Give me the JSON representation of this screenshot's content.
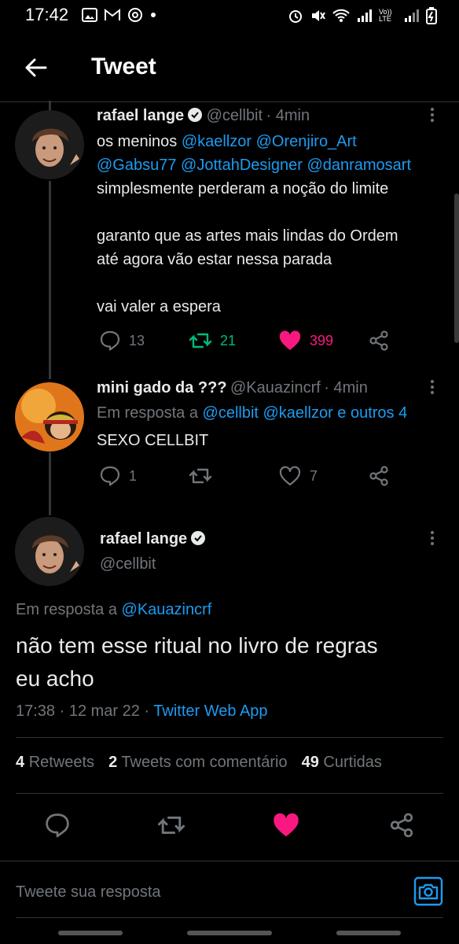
{
  "status_bar": {
    "time": "17:42",
    "left_icons": [
      "image-icon",
      "gmail-icon",
      "at-icon",
      "dot-icon"
    ],
    "right_icons": [
      "alarm-icon",
      "mute-icon",
      "wifi-icon",
      "signal-icon",
      "volte-icon",
      "signal-icon-2",
      "battery-icon"
    ],
    "volte_label": "Vo)) LTE"
  },
  "header": {
    "title": "Tweet"
  },
  "tweets": [
    {
      "name": "rafael lange",
      "handle": "@cellbit",
      "time": "· 4min",
      "lines": [
        [
          "os meninos ",
          {
            "link": "@kaellzor"
          },
          " ",
          {
            "link": "@Orenjiro_Art"
          }
        ],
        [
          {
            "link": "@Gabsu77"
          },
          " ",
          {
            "link": "@JottahDesigner"
          },
          " ",
          {
            "link": "@danramosart"
          }
        ],
        [
          "simplesmente perderam a noção do limite"
        ],
        [
          ""
        ],
        [
          "garanto que as artes mais lindas do Ordem"
        ],
        [
          "até agora vão estar nessa parada"
        ],
        [
          ""
        ],
        [
          "vai valer a espera"
        ]
      ],
      "replies": "13",
      "retweets": "21",
      "likes": "399"
    },
    {
      "name": "mini gado da ???",
      "handle": "@Kauazincrf",
      "time": "· 4min",
      "reply_prefix": "Em resposta a ",
      "reply_to": "@cellbit @kaellzor e outros 4",
      "text": "SEXO CELLBIT",
      "replies": "1",
      "likes": "7"
    }
  ],
  "main_tweet": {
    "name": "rafael lange",
    "handle": "@cellbit",
    "reply_prefix": "Em resposta a ",
    "reply_to": "@Kauazincrf",
    "text_line1": "não tem esse ritual no livro de regras",
    "text_line2": "eu acho",
    "meta_time": "17:38 · 12 mar 22 · ",
    "meta_source": "Twitter Web App",
    "retweets_count": "4",
    "retweets_label": "Retweets",
    "quotes_count": "2",
    "quotes_label": "Tweets com comentário",
    "likes_count": "49",
    "likes_label": "Curtidas"
  },
  "reply_bar": {
    "placeholder": "Tweete sua resposta"
  },
  "colors": {
    "link": "#1d9bf0",
    "like": "#f91880",
    "retweet": "#00ba7c",
    "muted": "#71767b",
    "background": "#000000"
  }
}
